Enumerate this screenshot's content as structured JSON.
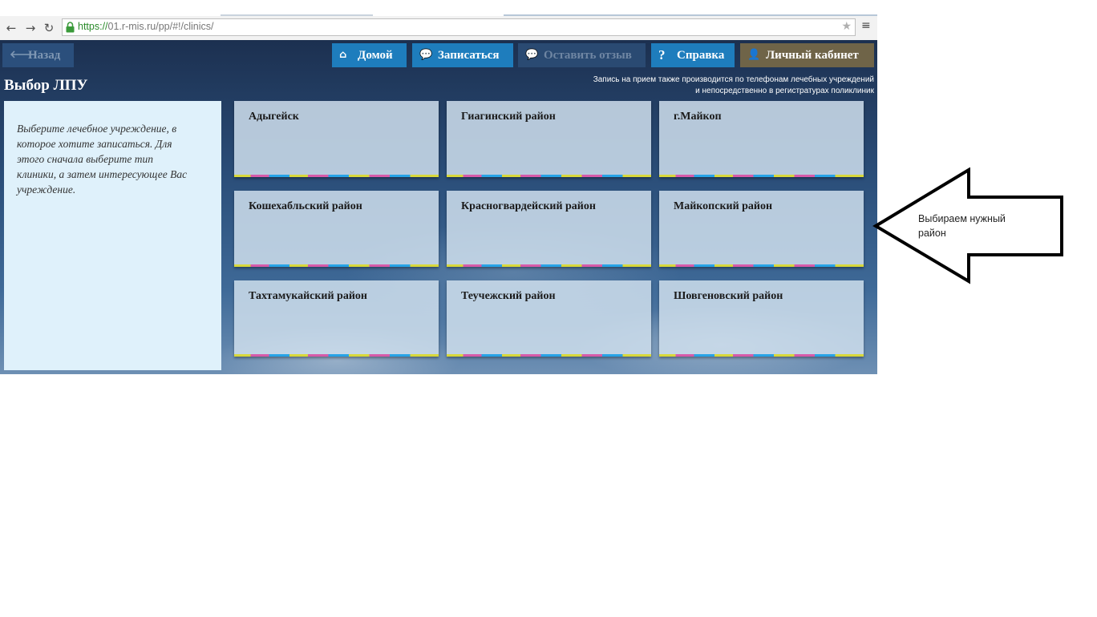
{
  "browser": {
    "url_scheme": "https://",
    "url_rest": "01.r-mis.ru/pp/#!/clinics/",
    "back_glyph": "←",
    "forward_glyph": "→",
    "reload_glyph": "↻",
    "star_glyph": "★",
    "menu_glyph": "≡"
  },
  "nav": {
    "back": "Назад",
    "home": "Домой",
    "sign_up": "Записаться",
    "review": "Оставить отзыв",
    "help": "Справка",
    "cabinet": "Личный кабинет",
    "icons": {
      "back": "arrow-left-icon",
      "home": "home-icon",
      "sign_up": "speech-bubble-icon",
      "review": "speech-bubble-icon",
      "help": "question-icon",
      "cabinet": "user-icon"
    },
    "glyphs": {
      "back": "🡐",
      "home": "⌂",
      "sign_up": "💬",
      "review": "💬",
      "help": "?",
      "cabinet": "👤"
    }
  },
  "page": {
    "title": "Выбор ЛПУ",
    "notice_line1": "Запись на прием также производится по телефонам лечебных учреждений",
    "notice_line2": "и непосредственно в регистратурах поликлиник",
    "instruction": "Выберите лечебное учреждение, в которое хотите записаться. Для этого сначала выберите тип клиники, а затем интересующее Вас учреждение."
  },
  "districts": [
    "Адыгейск",
    "Гиагинский район",
    "г.Майкоп",
    "Кошехабльский район",
    "Красногвардейский район",
    "Майкопский район",
    "Тахтамукайский район",
    "Теучежский район",
    "Шовгеновский район"
  ],
  "annotation": {
    "line1": "Выбираем нужный",
    "line2": "район"
  },
  "colors": {
    "nav_active": "#1e7dbd",
    "nav_disabled": "#2a4a72",
    "cabinet": "#6f6448",
    "panel": "#dff1fb",
    "tile": "#cedeec"
  }
}
